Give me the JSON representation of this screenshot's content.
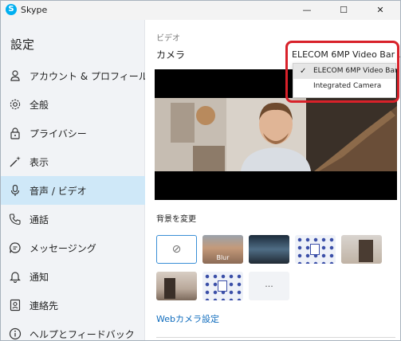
{
  "window": {
    "title": "Skype",
    "logo": "S",
    "min_glyph": "—",
    "max_glyph": "☐",
    "close_glyph": "✕"
  },
  "sidebar": {
    "title": "設定",
    "items": [
      {
        "label": "アカウント & プロフィール",
        "icon": "person-icon"
      },
      {
        "label": "全般",
        "icon": "gear-icon"
      },
      {
        "label": "プライバシー",
        "icon": "lock-icon"
      },
      {
        "label": "表示",
        "icon": "magic-wand-icon"
      },
      {
        "label": "音声 / ビデオ",
        "icon": "microphone-icon"
      },
      {
        "label": "通話",
        "icon": "phone-icon"
      },
      {
        "label": "メッセージング",
        "icon": "chat-icon"
      },
      {
        "label": "通知",
        "icon": "bell-icon"
      },
      {
        "label": "連絡先",
        "icon": "contact-card-icon"
      },
      {
        "label": "ヘルプとフィードバック",
        "icon": "info-icon"
      }
    ],
    "active_index": 4
  },
  "main": {
    "section_label": "ビデオ",
    "camera_label": "カメラ",
    "camera_selected": "ELECOM 6MP Video Bar",
    "background_label": "背景を変更",
    "background_tiles": [
      {
        "name": "none",
        "glyph": "⊘"
      },
      {
        "name": "blur",
        "label": "Blur"
      },
      {
        "name": "water"
      },
      {
        "name": "pattern"
      },
      {
        "name": "room"
      },
      {
        "name": "room2"
      },
      {
        "name": "pattern2"
      },
      {
        "name": "more",
        "glyph": "···"
      }
    ],
    "webcam_settings_link": "Webカメラ設定"
  },
  "dropdown": {
    "options": [
      "ELECOM 6MP Video Bar",
      "Integrated Camera"
    ],
    "selected_index": 0,
    "check_glyph": "✓"
  },
  "colors": {
    "accent": "#0f6cbd",
    "active_nav": "#cfe8f8",
    "highlight": "#d8212a",
    "skype_blue": "#00aff0"
  }
}
